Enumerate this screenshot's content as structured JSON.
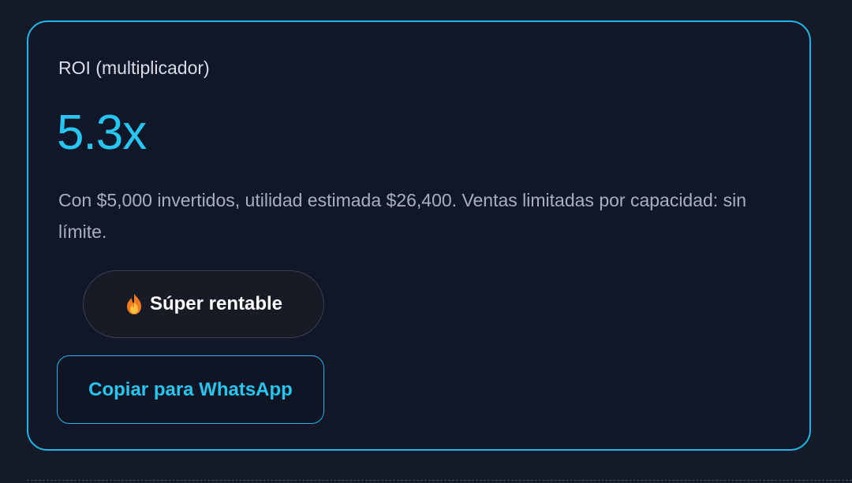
{
  "roi_card": {
    "label": "ROI (multiplicador)",
    "value": "5.3x",
    "description": "Con $5,000 invertidos, utilidad estimada $26,400. Ventas limitadas por capacidad: sin límite.",
    "badge": {
      "icon": "fire-icon",
      "text": "Súper rentable"
    },
    "copy_button_label": "Copiar para WhatsApp"
  },
  "colors": {
    "background": "#141a27",
    "card_background": "#111729",
    "accent": "#27c6f1",
    "card_border": "#1fb6e6",
    "muted_text": "#a8b0bf"
  }
}
